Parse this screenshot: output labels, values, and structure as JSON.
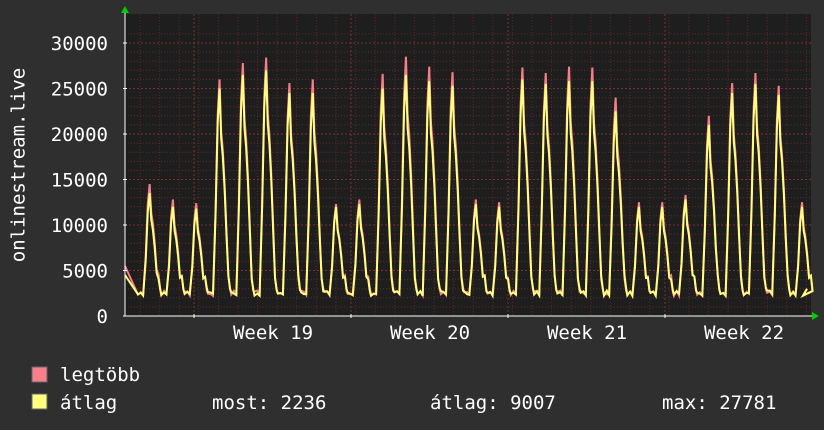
{
  "chart_data": {
    "type": "line",
    "ylabel": "onlinestream.live",
    "ylim": [
      0,
      30000
    ],
    "y_ticks": [
      0,
      5000,
      10000,
      15000,
      20000,
      25000,
      30000
    ],
    "x_ticks": [
      "Week 19",
      "Week 20",
      "Week 21",
      "Week 22"
    ],
    "grid": true,
    "daily_peaks": {
      "max": [
        14500,
        12800,
        12400,
        26000,
        27800,
        28400,
        25600,
        26000,
        12300,
        12800,
        26600,
        28500,
        27400,
        26800,
        12800,
        12500,
        27300,
        26700,
        27400,
        27300,
        24000,
        12500,
        12500,
        13300,
        22000,
        25600,
        26700,
        25300,
        12500
      ],
      "avg": [
        13500,
        12000,
        11800,
        25000,
        26500,
        27000,
        24500,
        24500,
        12000,
        12300,
        25000,
        26500,
        25800,
        25300,
        12300,
        12000,
        26000,
        25500,
        25800,
        25800,
        22500,
        12000,
        12000,
        12800,
        21000,
        24500,
        25500,
        24300,
        12000
      ]
    },
    "series": [
      {
        "name": "legtöbb",
        "color": "#f77f89"
      },
      {
        "name": "átlag",
        "color": "#ffff80"
      }
    ],
    "stats": {
      "now": "most: 2236",
      "avg": "átlag: 9007",
      "max": "max: 27781"
    },
    "colors": {
      "background": "#2f2f2f",
      "plot_background": "#1e1e1e",
      "grid_minor": "#5a2a2a",
      "grid_major": "#7a3030",
      "axis": "#ffffff",
      "arrow": "#00cc00"
    }
  }
}
